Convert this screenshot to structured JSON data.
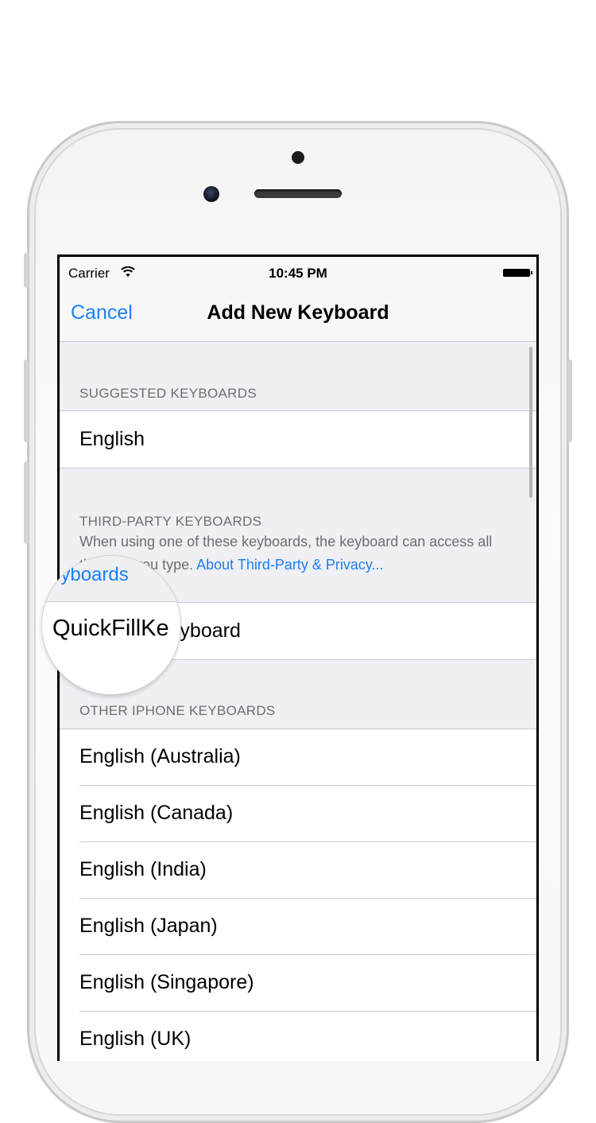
{
  "status_bar": {
    "carrier": "Carrier",
    "time": "10:45 PM"
  },
  "nav": {
    "cancel_label": "Cancel",
    "title": "Add New Keyboard"
  },
  "sections": {
    "suggested": {
      "header": "SUGGESTED KEYBOARDS",
      "items": [
        "English"
      ]
    },
    "third_party": {
      "header": "THIRD-PARTY KEYBOARDS",
      "footer_text": "When using one of these keyboards, the keyboard can access all the data you type.",
      "footer_link_part1": "About Third-Party",
      "footer_link_part2": "& Privacy...",
      "items": [
        "QuickFillKeyboard"
      ]
    },
    "other": {
      "header": "OTHER IPHONE KEYBOARDS",
      "items": [
        "English (Australia)",
        "English (Canada)",
        "English (India)",
        "English (Japan)",
        "English (Singapore)",
        "English (UK)"
      ]
    }
  },
  "magnifier": {
    "link_text": "eyboards",
    "label_text": "QuickFillKe"
  },
  "colors": {
    "accent": "#1a80f5",
    "group_bg": "#efeff4",
    "header_text": "#6d6d72",
    "separator": "#c8c7cc"
  }
}
